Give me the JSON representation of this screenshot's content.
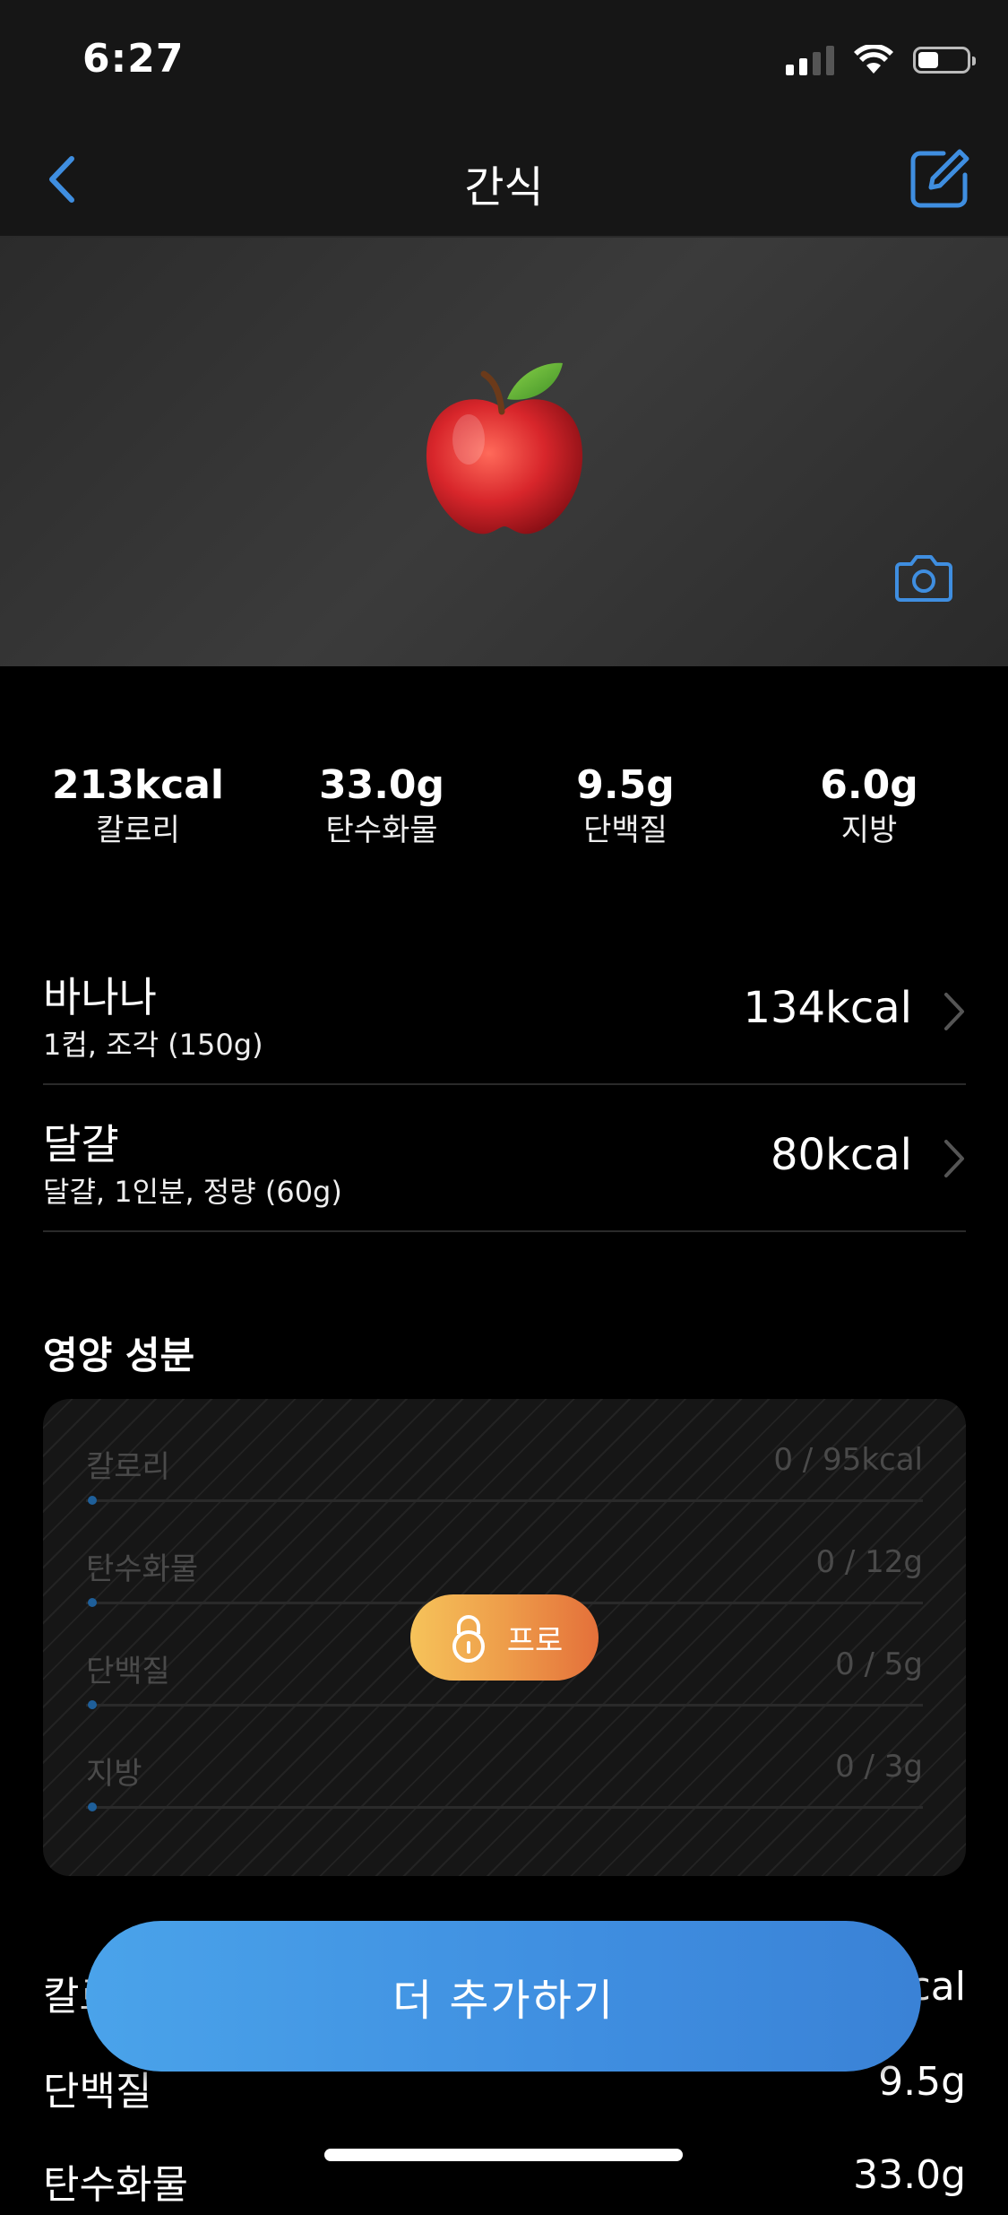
{
  "status_bar": {
    "time": "6:27"
  },
  "nav": {
    "title": "간식"
  },
  "macros": [
    {
      "value": "213kcal",
      "label": "칼로리"
    },
    {
      "value": "33.0g",
      "label": "탄수화물"
    },
    {
      "value": "9.5g",
      "label": "단백질"
    },
    {
      "value": "6.0g",
      "label": "지방"
    }
  ],
  "foods": [
    {
      "name": "바나나",
      "portion": "1컵, 조각 (150g)",
      "kcal": "134kcal"
    },
    {
      "name": "달걀",
      "portion": "달걀, 1인분, 정량 (60g)",
      "kcal": "80kcal"
    }
  ],
  "nutrients": {
    "title": "영양 성분",
    "rows": [
      {
        "label": "칼로리",
        "value": "0 / 95kcal"
      },
      {
        "label": "탄수화물",
        "value": "0 / 12g"
      },
      {
        "label": "단백질",
        "value": "0 / 5g"
      },
      {
        "label": "지방",
        "value": "0 / 3g"
      }
    ],
    "pro_label": "프로"
  },
  "summary": [
    {
      "label": "칼로",
      "value": "cal"
    },
    {
      "label": "단백질",
      "value": "9.5g"
    },
    {
      "label": "탄수화물",
      "value": "33.0g"
    }
  ],
  "add_button": {
    "label": "더 추가하기"
  },
  "colors": {
    "accent": "#3f8ee0",
    "pro_start": "#f6c35a",
    "pro_end": "#e4703a"
  }
}
